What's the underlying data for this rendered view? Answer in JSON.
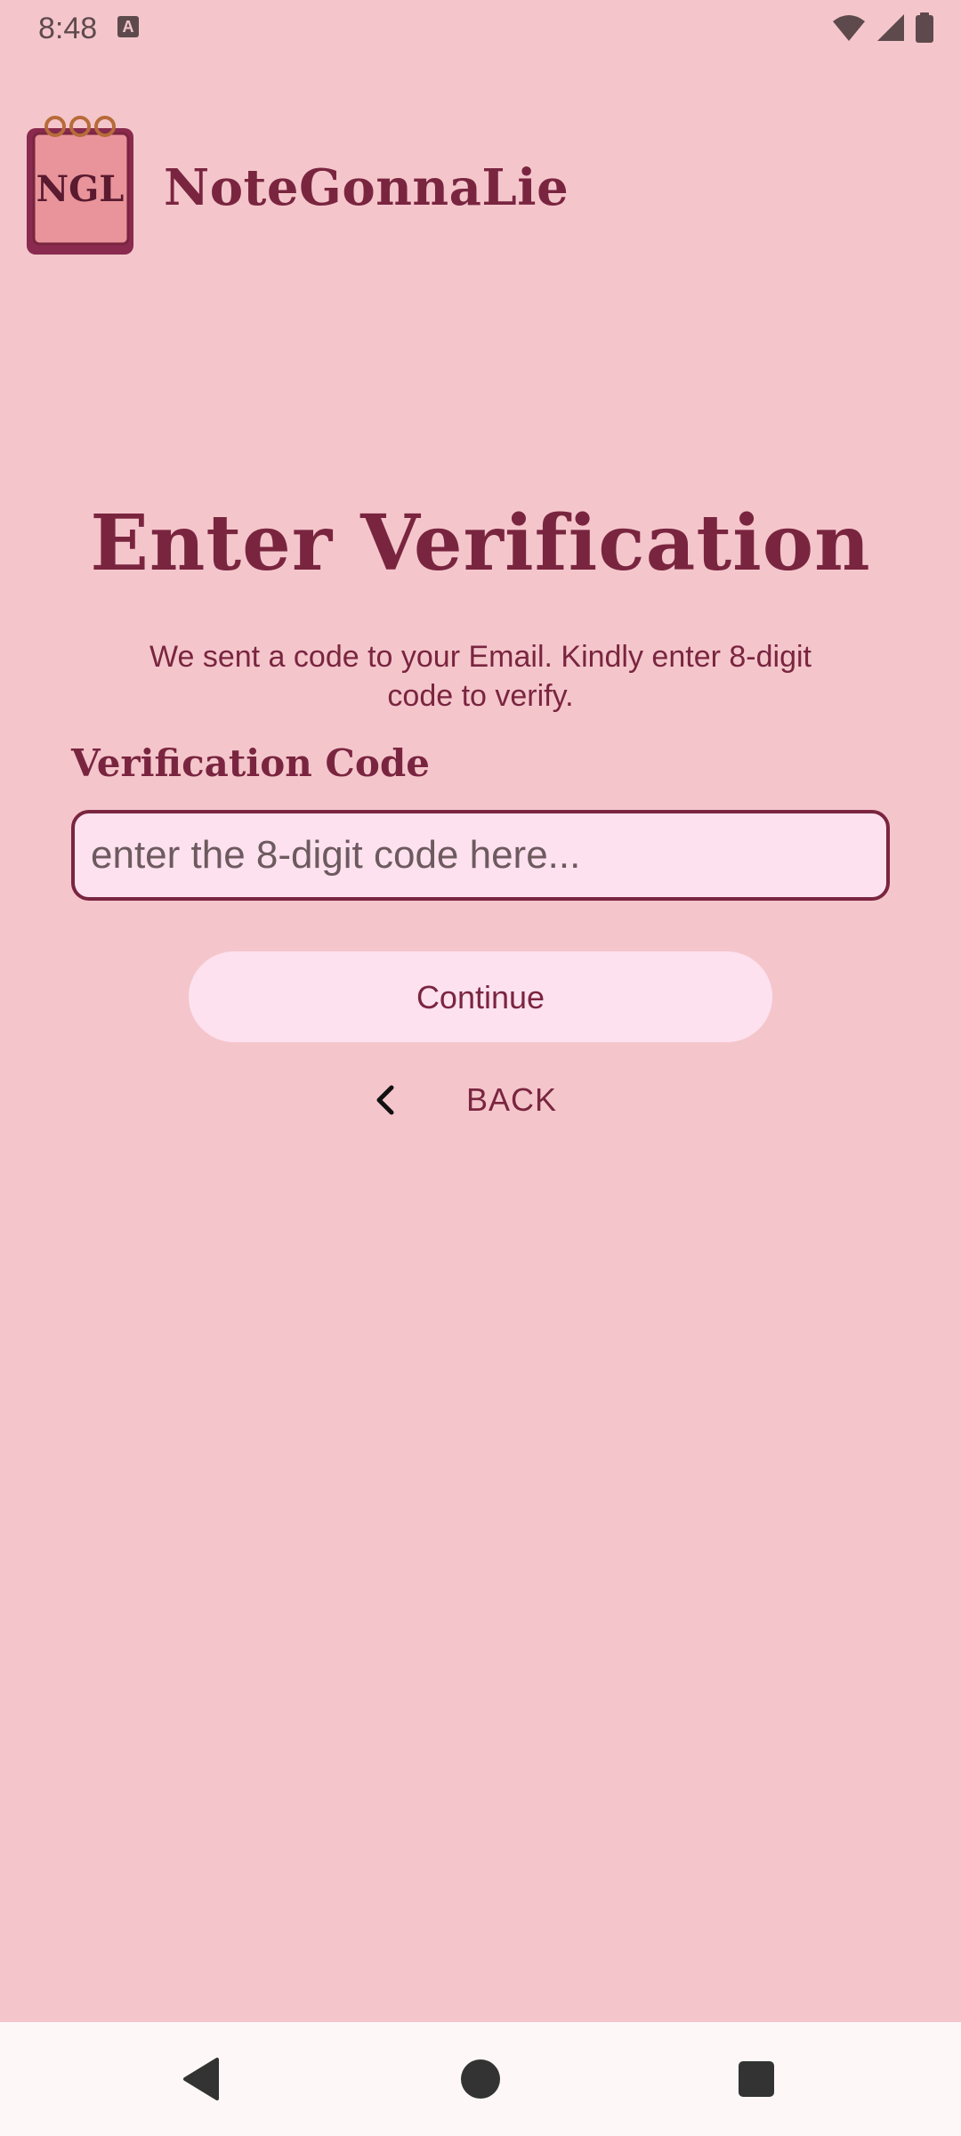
{
  "status_bar": {
    "time": "8:48",
    "notification_icon": "a-icon",
    "icons": [
      "wifi-icon",
      "signal-icon",
      "battery-icon"
    ]
  },
  "header": {
    "logo_text": "NGL",
    "app_name": "NoteGonnaLie"
  },
  "main": {
    "title": "Enter Verification",
    "subtitle": "We sent a code to your Email. Kindly enter 8-digit code to verify.",
    "field_label": "Verification Code",
    "code_input": {
      "value": "",
      "placeholder": "enter the 8-digit code here..."
    },
    "continue_label": "Continue",
    "back_label": "BACK"
  },
  "nav_bar": {
    "buttons": [
      "back-icon",
      "home-icon",
      "recents-icon"
    ]
  },
  "colors": {
    "background": "#f4c6cb",
    "accent": "#7a2540",
    "input_fill": "#fde1ef",
    "nav_bar": "#fdf7f7"
  }
}
